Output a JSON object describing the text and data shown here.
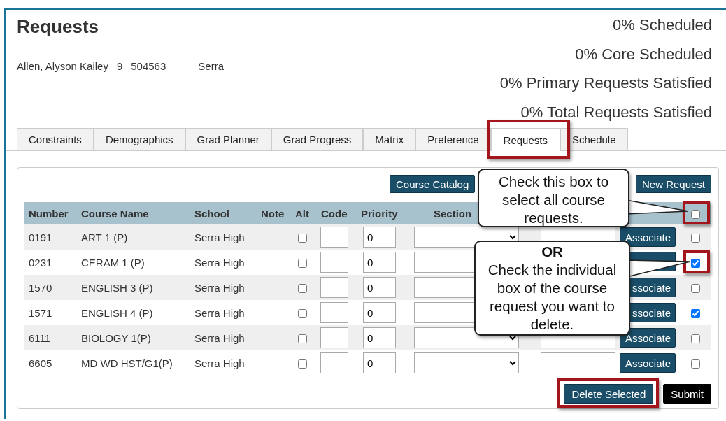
{
  "page": {
    "title": "Requests",
    "student": {
      "name": "Allen, Alyson Kailey",
      "grade": "9",
      "id": "504563",
      "school": "Serra"
    },
    "stats": [
      "0% Scheduled",
      "0% Core Scheduled",
      "0% Primary Requests Satisfied",
      "0% Total Requests Satisfied"
    ]
  },
  "tabs": [
    {
      "label": "Constraints",
      "selected": false
    },
    {
      "label": "Demographics",
      "selected": false
    },
    {
      "label": "Grad Planner",
      "selected": false
    },
    {
      "label": "Grad Progress",
      "selected": false
    },
    {
      "label": "Matrix",
      "selected": false
    },
    {
      "label": "Preference",
      "selected": false
    },
    {
      "label": "Requests",
      "selected": true
    },
    {
      "label": "Schedule",
      "selected": false
    }
  ],
  "toolbar": {
    "buttons": [
      "Course Catalog",
      "New Request"
    ]
  },
  "table": {
    "columns": [
      "Number",
      "Course Name",
      "School",
      "Note",
      "Alt",
      "Code",
      "Priority",
      "Section"
    ],
    "select_all": {
      "checked": false
    },
    "rows": [
      {
        "number": "0191",
        "course_name": "ART 1 (P)",
        "school": "Serra High",
        "alt": false,
        "priority": "0",
        "associate": "Associate",
        "selected": false
      },
      {
        "number": "0231",
        "course_name": "CERAM 1 (P)",
        "school": "Serra High",
        "alt": false,
        "priority": "0",
        "selected": true
      },
      {
        "number": "1570",
        "course_name": "ENGLISH 3 (P)",
        "school": "Serra High",
        "alt": false,
        "priority": "0",
        "associate": "ssociate",
        "selected": false
      },
      {
        "number": "1571",
        "course_name": "ENGLISH 4 (P)",
        "school": "Serra High",
        "alt": false,
        "priority": "0",
        "associate": "ssociate",
        "selected": true
      },
      {
        "number": "6111",
        "course_name": "BIOLOGY 1(P)",
        "school": "Serra High",
        "alt": false,
        "priority": "0",
        "associate": "Associate",
        "selected": false
      },
      {
        "number": "6605",
        "course_name": "MD WD HST/G1(P)",
        "school": "Serra High",
        "alt": false,
        "priority": "0",
        "associate": "Associate",
        "selected": false
      }
    ]
  },
  "footer_buttons": [
    {
      "label": "Delete Selected",
      "kind": "primary"
    },
    {
      "label": "Submit",
      "kind": "dark"
    }
  ],
  "annotations": {
    "callouts": [
      {
        "kind": "select-all",
        "text": "Check this box to select all course requests."
      },
      {
        "kind": "individual",
        "heading": "OR",
        "text": "Check the individual box of the course request you want to delete."
      }
    ],
    "highlights": [
      {
        "kind": "tab"
      },
      {
        "kind": "select-all"
      },
      {
        "kind": "row"
      },
      {
        "kind": "delete"
      }
    ]
  }
}
